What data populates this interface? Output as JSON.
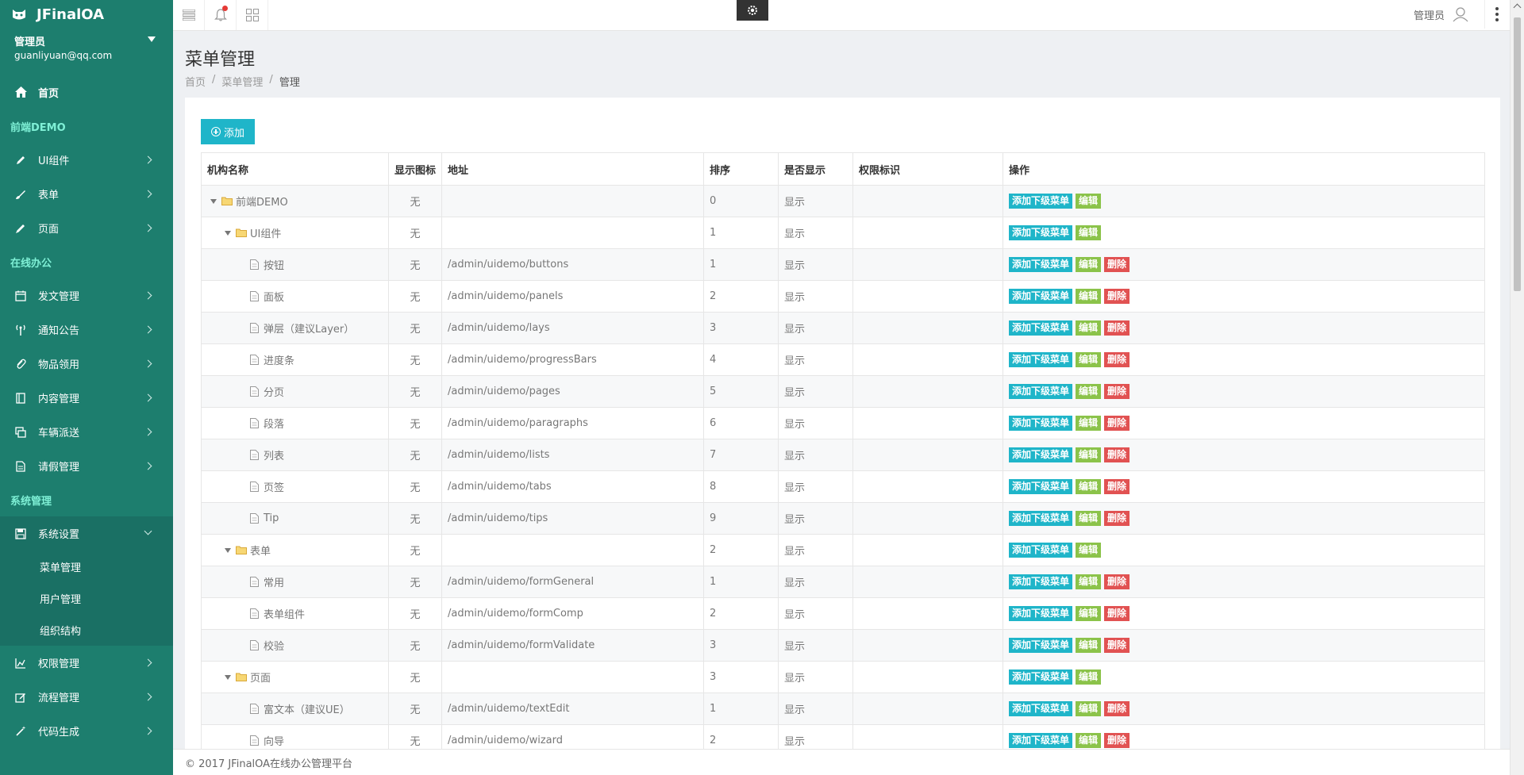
{
  "app": {
    "name": "JFinalOA"
  },
  "user": {
    "name": "管理员",
    "email": "guanliyuan@qq.com"
  },
  "colors": {
    "sidebar": "#1d7e6e",
    "accent": "#1fb5c9",
    "edit": "#8bc34a",
    "delete": "#e15252",
    "section": "#7ff0d6"
  },
  "sidebar": {
    "home": {
      "label": "首页",
      "icon": "home-icon"
    },
    "sections": [
      {
        "title": "前端DEMO",
        "items": [
          {
            "label": "UI组件",
            "icon": "pencil-icon"
          },
          {
            "label": "表单",
            "icon": "brush-icon"
          },
          {
            "label": "页面",
            "icon": "pen-icon"
          }
        ]
      },
      {
        "title": "在线办公",
        "items": [
          {
            "label": "发文管理",
            "icon": "calendar-icon"
          },
          {
            "label": "通知公告",
            "icon": "antenna-icon"
          },
          {
            "label": "物品领用",
            "icon": "paperclip-icon"
          },
          {
            "label": "内容管理",
            "icon": "book-icon"
          },
          {
            "label": "车辆派送",
            "icon": "clone-icon"
          },
          {
            "label": "请假管理",
            "icon": "file-icon"
          }
        ]
      },
      {
        "title": "系统管理",
        "items": [
          {
            "label": "系统设置",
            "icon": "save-icon",
            "open": true,
            "children": [
              "菜单管理",
              "用户管理",
              "组织结构"
            ]
          },
          {
            "label": "权限管理",
            "icon": "chart-icon"
          },
          {
            "label": "流程管理",
            "icon": "edit-icon"
          },
          {
            "label": "代码生成",
            "icon": "magic-wand-icon"
          }
        ]
      }
    ]
  },
  "topbar": {
    "user_label": "管理员"
  },
  "page": {
    "title": "菜单管理",
    "breadcrumb": [
      "首页",
      "菜单管理",
      "管理"
    ],
    "add_button": "添加"
  },
  "table": {
    "headers": [
      "机构名称",
      "显示图标",
      "地址",
      "排序",
      "是否显示",
      "权限标识",
      "操作"
    ],
    "actions": {
      "add_child": "添加下级菜单",
      "edit": "编辑",
      "delete": "删除"
    },
    "rows": [
      {
        "name": "前端DEMO",
        "level": 0,
        "type": "folder",
        "icon": "无",
        "url": "",
        "sort": "0",
        "visible": "显示",
        "perm": "",
        "deletable": false
      },
      {
        "name": "UI组件",
        "level": 1,
        "type": "folder",
        "icon": "无",
        "url": "",
        "sort": "1",
        "visible": "显示",
        "perm": "",
        "deletable": false
      },
      {
        "name": "按钮",
        "level": 2,
        "type": "file",
        "icon": "无",
        "url": "/admin/uidemo/buttons",
        "sort": "1",
        "visible": "显示",
        "perm": "",
        "deletable": true
      },
      {
        "name": "面板",
        "level": 2,
        "type": "file",
        "icon": "无",
        "url": "/admin/uidemo/panels",
        "sort": "2",
        "visible": "显示",
        "perm": "",
        "deletable": true
      },
      {
        "name": "弹层（建议Layer）",
        "level": 2,
        "type": "file",
        "icon": "无",
        "url": "/admin/uidemo/lays",
        "sort": "3",
        "visible": "显示",
        "perm": "",
        "deletable": true
      },
      {
        "name": "进度条",
        "level": 2,
        "type": "file",
        "icon": "无",
        "url": "/admin/uidemo/progressBars",
        "sort": "4",
        "visible": "显示",
        "perm": "",
        "deletable": true
      },
      {
        "name": "分页",
        "level": 2,
        "type": "file",
        "icon": "无",
        "url": "/admin/uidemo/pages",
        "sort": "5",
        "visible": "显示",
        "perm": "",
        "deletable": true
      },
      {
        "name": "段落",
        "level": 2,
        "type": "file",
        "icon": "无",
        "url": "/admin/uidemo/paragraphs",
        "sort": "6",
        "visible": "显示",
        "perm": "",
        "deletable": true
      },
      {
        "name": "列表",
        "level": 2,
        "type": "file",
        "icon": "无",
        "url": "/admin/uidemo/lists",
        "sort": "7",
        "visible": "显示",
        "perm": "",
        "deletable": true
      },
      {
        "name": "页签",
        "level": 2,
        "type": "file",
        "icon": "无",
        "url": "/admin/uidemo/tabs",
        "sort": "8",
        "visible": "显示",
        "perm": "",
        "deletable": true
      },
      {
        "name": "Tip",
        "level": 2,
        "type": "file",
        "icon": "无",
        "url": "/admin/uidemo/tips",
        "sort": "9",
        "visible": "显示",
        "perm": "",
        "deletable": true
      },
      {
        "name": "表单",
        "level": 1,
        "type": "folder",
        "icon": "无",
        "url": "",
        "sort": "2",
        "visible": "显示",
        "perm": "",
        "deletable": false
      },
      {
        "name": "常用",
        "level": 2,
        "type": "file",
        "icon": "无",
        "url": "/admin/uidemo/formGeneral",
        "sort": "1",
        "visible": "显示",
        "perm": "",
        "deletable": true
      },
      {
        "name": "表单组件",
        "level": 2,
        "type": "file",
        "icon": "无",
        "url": "/admin/uidemo/formComp",
        "sort": "2",
        "visible": "显示",
        "perm": "",
        "deletable": true
      },
      {
        "name": "校验",
        "level": 2,
        "type": "file",
        "icon": "无",
        "url": "/admin/uidemo/formValidate",
        "sort": "3",
        "visible": "显示",
        "perm": "",
        "deletable": true
      },
      {
        "name": "页面",
        "level": 1,
        "type": "folder",
        "icon": "无",
        "url": "",
        "sort": "3",
        "visible": "显示",
        "perm": "",
        "deletable": false
      },
      {
        "name": "富文本（建议UE）",
        "level": 2,
        "type": "file",
        "icon": "无",
        "url": "/admin/uidemo/textEdit",
        "sort": "1",
        "visible": "显示",
        "perm": "",
        "deletable": true
      },
      {
        "name": "向导",
        "level": 2,
        "type": "file",
        "icon": "无",
        "url": "/admin/uidemo/wizard",
        "sort": "2",
        "visible": "显示",
        "perm": "",
        "deletable": true
      }
    ]
  },
  "footer": {
    "text": "© 2017 JFinalOA在线办公管理平台"
  }
}
